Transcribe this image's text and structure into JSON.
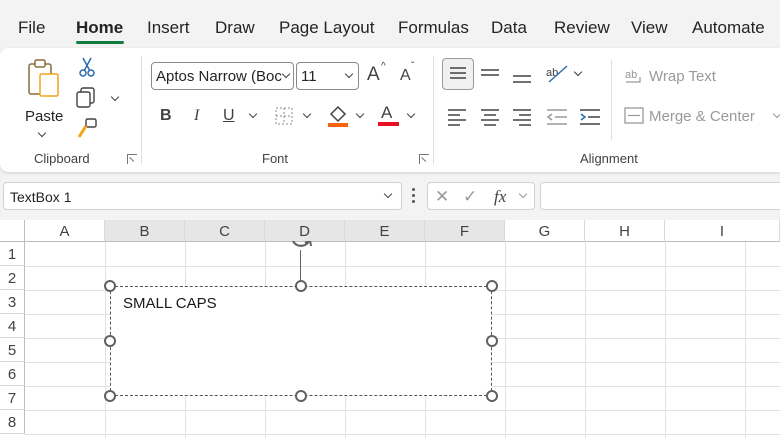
{
  "tabs": {
    "file": "File",
    "home": "Home",
    "insert": "Insert",
    "draw": "Draw",
    "page_layout": "Page Layout",
    "formulas": "Formulas",
    "data": "Data",
    "review": "Review",
    "view": "View",
    "automate": "Automate"
  },
  "clipboard": {
    "paste_label": "Paste",
    "group_label": "Clipboard"
  },
  "font": {
    "font_name": "Aptos Narrow (Boc",
    "font_size": "11",
    "bold": "B",
    "italic": "I",
    "underline": "U",
    "font_color_glyph": "A",
    "grow_glyph": "A",
    "shrink_glyph": "A",
    "group_label": "Font",
    "font_color": "#e81123",
    "fill_color": "#f7630c"
  },
  "alignment": {
    "wrap_text": "Wrap Text",
    "merge_center": "Merge & Center",
    "group_label": "Alignment"
  },
  "formula_bar": {
    "name_box": "TextBox 1",
    "fx": "fx",
    "cancel": "✕",
    "enter": "✓"
  },
  "sheet": {
    "columns": [
      "A",
      "B",
      "C",
      "D",
      "E",
      "F",
      "G",
      "H",
      "I"
    ],
    "selected_columns": [
      "B",
      "C",
      "D",
      "E",
      "F"
    ],
    "rows": [
      "1",
      "2",
      "3",
      "4",
      "5",
      "6",
      "7",
      "8"
    ]
  },
  "textbox": {
    "text": "SMALL CAPS"
  },
  "icons": [
    "cut-icon",
    "copy-icon",
    "format-painter-icon",
    "paste-icon",
    "borders-icon",
    "fill-color-icon",
    "orientation-icon",
    "wrap-text-icon",
    "merge-center-icon",
    "rotate-handle-icon"
  ]
}
